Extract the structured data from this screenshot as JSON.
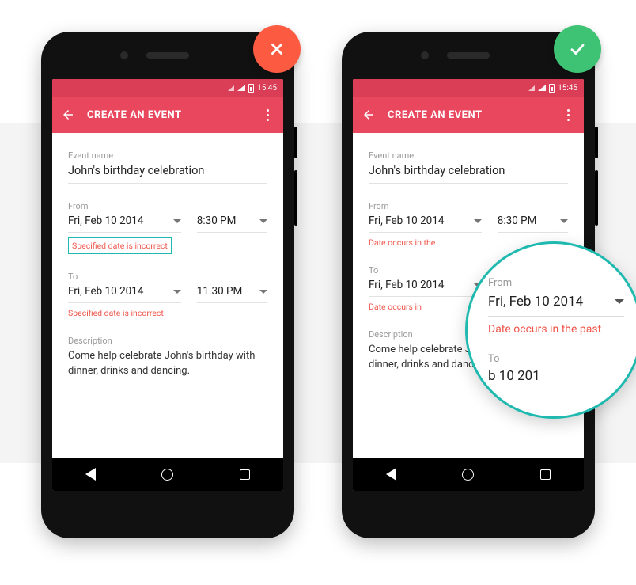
{
  "statusbar": {
    "time": "15:45"
  },
  "appbar": {
    "title": "CREATE AN EVENT"
  },
  "event": {
    "name_label": "Event name",
    "name_value": "John's birthday celebration",
    "from_label": "From",
    "from_date": "Fri, Feb 10 2014",
    "from_time": "8:30 PM",
    "to_label": "To",
    "to_date": "Fri, Feb 10 2014",
    "to_time": "11.30 PM",
    "desc_label": "Description",
    "desc_value": "Come help celebrate John's birthday with dinner, drinks and dancing."
  },
  "errors": {
    "bad": "Specified date is incorrect",
    "good": "Date occurs in the past",
    "good_truncated_from": "Date occurs in the",
    "good_truncated_to": "Date occurs in"
  },
  "magnifier": {
    "from_label": "From",
    "from_date": "Fri, Feb 10 2014",
    "error": "Date occurs in the past",
    "to_label": "To",
    "to_date_partial": "b 10 201"
  }
}
